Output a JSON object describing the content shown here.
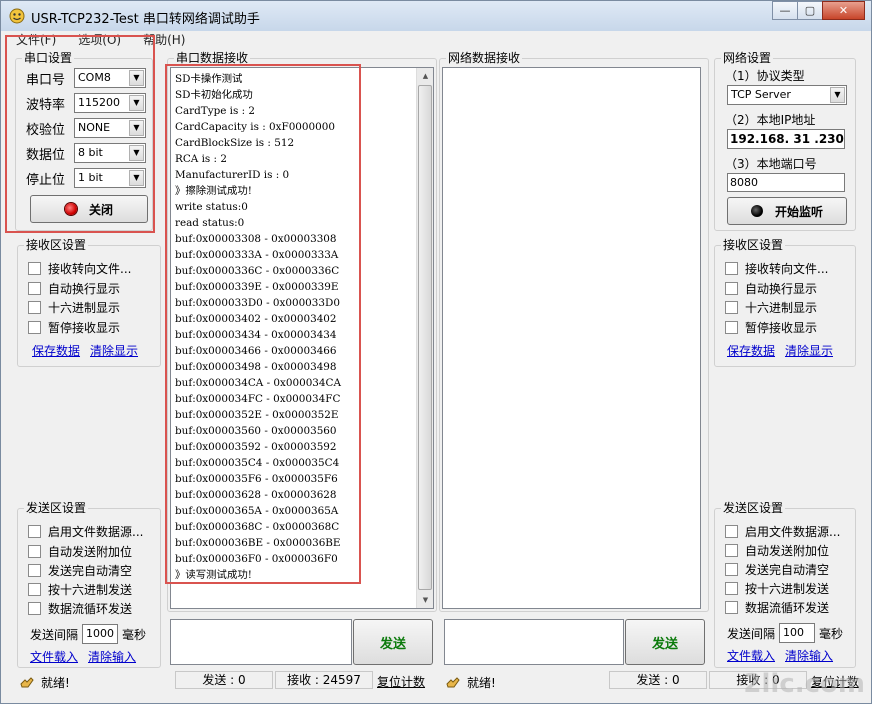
{
  "window": {
    "title": "USR-TCP232-Test 串口转网络调试助手",
    "min": "—",
    "max": "▢",
    "close": "✕"
  },
  "menu": [
    "文件(F)",
    "选项(O)",
    "帮助(H)"
  ],
  "serial_settings": {
    "label": "串口设置",
    "rows": [
      {
        "label": "串口号",
        "value": "COM8"
      },
      {
        "label": "波特率",
        "value": "115200"
      },
      {
        "label": "校验位",
        "value": "NONE"
      },
      {
        "label": "数据位",
        "value": "8 bit"
      },
      {
        "label": "停止位",
        "value": "1 bit"
      }
    ],
    "close_button": "关闭"
  },
  "left_receive": {
    "label": "接收区设置",
    "options": [
      "接收转向文件...",
      "自动换行显示",
      "十六进制显示",
      "暂停接收显示"
    ],
    "save_link": "保存数据",
    "clear_link": "清除显示"
  },
  "left_send": {
    "label": "发送区设置",
    "options": [
      "启用文件数据源...",
      "自动发送附加位",
      "发送完自动清空",
      "按十六进制发送",
      "数据流循环发送"
    ],
    "interval_label": "发送间隔",
    "interval_value": "1000",
    "interval_unit": "毫秒",
    "load_link": "文件载入",
    "clear_link": "清除输入"
  },
  "serial_receive": {
    "label": "串口数据接收",
    "lines": [
      "SD卡操作测试",
      "SD卡初始化成功",
      "CardType is : 2",
      "CardCapacity is : 0xF0000000",
      "CardBlockSize is : 512",
      "RCA is : 2",
      "ManufacturerID is : 0",
      "》擦除测试成功!",
      "write status:0",
      "read status:0",
      "buf:0x00003308 - 0x00003308",
      "buf:0x0000333A - 0x0000333A",
      "buf:0x0000336C - 0x0000336C",
      "buf:0x0000339E - 0x0000339E",
      "buf:0x000033D0 - 0x000033D0",
      "buf:0x00003402 - 0x00003402",
      "buf:0x00003434 - 0x00003434",
      "buf:0x00003466 - 0x00003466",
      "buf:0x00003498 - 0x00003498",
      "buf:0x000034CA - 0x000034CA",
      "buf:0x000034FC - 0x000034FC",
      "buf:0x0000352E - 0x0000352E",
      "buf:0x00003560 - 0x00003560",
      "buf:0x00003592 - 0x00003592",
      "buf:0x000035C4 - 0x000035C4",
      "buf:0x000035F6 - 0x000035F6",
      "buf:0x00003628 - 0x00003628",
      "buf:0x0000365A - 0x0000365A",
      "buf:0x0000368C - 0x0000368C",
      "buf:0x000036BE - 0x000036BE",
      "buf:0x000036F0 - 0x000036F0",
      "》读写测试成功!"
    ]
  },
  "network_receive": {
    "label": "网络数据接收"
  },
  "send_button_left": "发送",
  "send_button_right": "发送",
  "network_settings": {
    "label": "网络设置",
    "protocol_label": "（1）协议类型",
    "protocol_value": "TCP Server",
    "ip_label": "（2）本地IP地址",
    "ip_value": "192.168. 31 .230",
    "port_label": "（3）本地端口号",
    "port_value": "8080",
    "listen_button": "开始监听"
  },
  "right_receive": {
    "label": "接收区设置",
    "options": [
      "接收转向文件...",
      "自动换行显示",
      "十六进制显示",
      "暂停接收显示"
    ],
    "save_link": "保存数据",
    "clear_link": "清除显示"
  },
  "right_send": {
    "label": "发送区设置",
    "options": [
      "启用文件数据源...",
      "自动发送附加位",
      "发送完自动清空",
      "按十六进制发送",
      "数据流循环发送"
    ],
    "interval_label": "发送间隔",
    "interval_value": "100",
    "interval_unit": "毫秒",
    "load_link": "文件载入",
    "clear_link": "清除输入"
  },
  "status": {
    "left_ready": "就绪!",
    "left_sent": "发送 : 0",
    "left_recv": "接收 : 24597",
    "left_reset": "复位计数",
    "right_ready": "就绪!",
    "right_sent": "发送 : 0",
    "right_recv": "接收 : 0",
    "right_reset": "复位计数"
  },
  "watermark": "2lic.com"
}
